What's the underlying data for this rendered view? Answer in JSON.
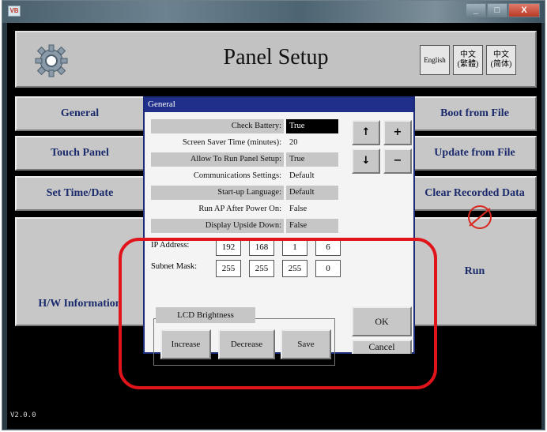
{
  "window": {
    "app_icon": "VB",
    "minimize_glyph": "_",
    "maximize_glyph": "□",
    "close_glyph": "X"
  },
  "header": {
    "title": "Panel Setup",
    "gear_icon": "gear-icon",
    "languages": {
      "english": "English",
      "traditional_chinese": "中文\n(繁體)",
      "simplified_chinese": "中文\n(简体)"
    }
  },
  "left_buttons": {
    "general": "General",
    "touch_panel": "Touch Panel",
    "set_time_date": "Set Time/Date",
    "hw_information": "H/W Information"
  },
  "right_buttons": {
    "boot_from_file": "Boot from File",
    "update_from_file": "Update from File",
    "clear_recorded_data": "Clear Recorded Data",
    "run": "Run"
  },
  "version": "V2.0.0",
  "dialog": {
    "title": "General",
    "properties": [
      {
        "label": "Check Battery:",
        "value": "True"
      },
      {
        "label": "Screen Saver Time (minutes):",
        "value": "20"
      },
      {
        "label": "Allow To Run Panel Setup:",
        "value": "True"
      },
      {
        "label": "Communications Settings:",
        "value": "Default"
      },
      {
        "label": "Start-up Language:",
        "value": "Default"
      },
      {
        "label": "Run AP After Power On:",
        "value": "False"
      },
      {
        "label": "Display Upside Down:",
        "value": "False"
      }
    ],
    "arrows": {
      "up": "↑",
      "down": "↓",
      "plus": "+",
      "minus": "−"
    },
    "ip_address": {
      "label": "IP Address:",
      "octets": [
        "192",
        "168",
        "1",
        "6"
      ]
    },
    "subnet_mask": {
      "label": "Subnet Mask:",
      "octets": [
        "255",
        "255",
        "255",
        "0"
      ]
    },
    "lcd_brightness": {
      "title": "LCD Brightness",
      "increase": "Increase",
      "decrease": "Decrease",
      "save": "Save"
    },
    "ok": "OK",
    "cancel": "Cancel"
  },
  "colors": {
    "dialog_title_bg": "#1f2f8a",
    "highlight_ring": "#e0141a",
    "button_text": "#1b2a6b"
  }
}
